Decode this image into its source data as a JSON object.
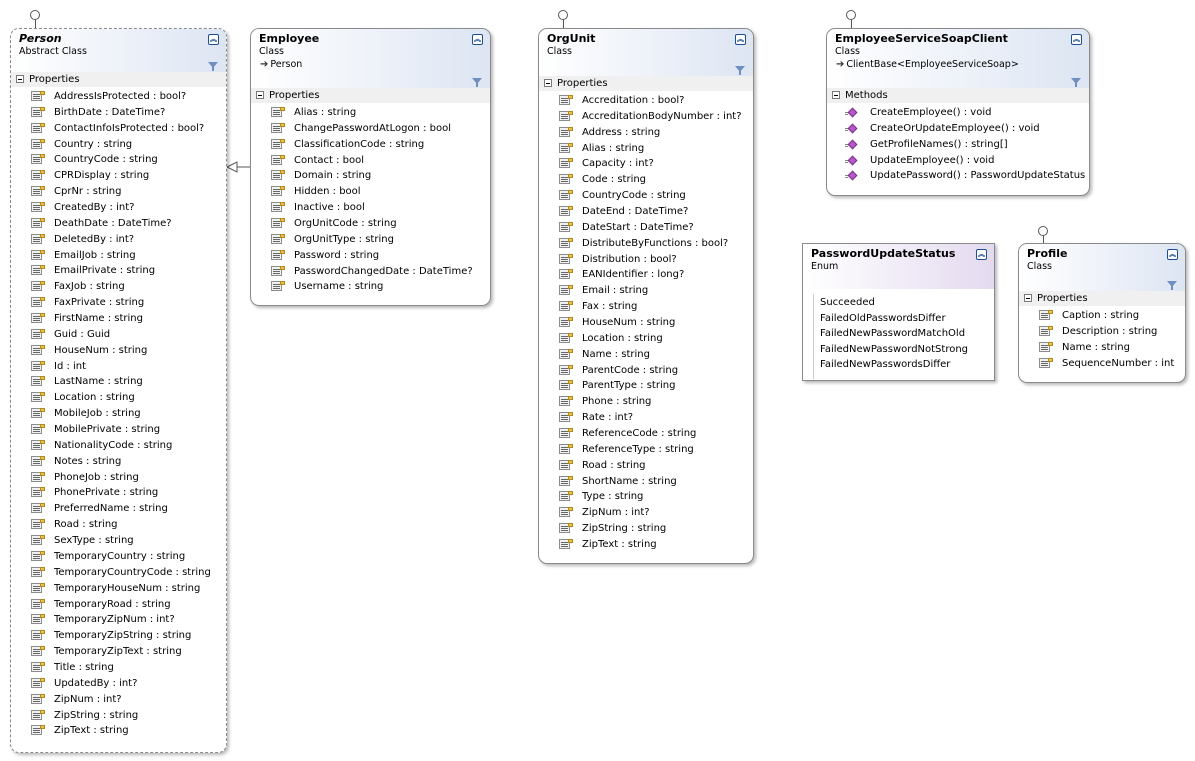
{
  "classes": {
    "person": {
      "name": "Person",
      "stereotype": "Abstract Class",
      "section": "Properties",
      "items": [
        "AddressIsProtected : bool?",
        "BirthDate : DateTime?",
        "ContactInfoIsProtected : bool?",
        "Country : string",
        "CountryCode : string",
        "CPRDisplay : string",
        "CprNr : string",
        "CreatedBy : int?",
        "DeathDate : DateTime?",
        "DeletedBy : int?",
        "EmailJob : string",
        "EmailPrivate : string",
        "FaxJob : string",
        "FaxPrivate : string",
        "FirstName : string",
        "Guid : Guid",
        "HouseNum : string",
        "Id : int",
        "LastName : string",
        "Location : string",
        "MobileJob : string",
        "MobilePrivate : string",
        "NationalityCode : string",
        "Notes : string",
        "PhoneJob : string",
        "PhonePrivate : string",
        "PreferredName : string",
        "Road : string",
        "SexType : string",
        "TemporaryCountry : string",
        "TemporaryCountryCode : string",
        "TemporaryHouseNum : string",
        "TemporaryRoad : string",
        "TemporaryZipNum : int?",
        "TemporaryZipString : string",
        "TemporaryZipText : string",
        "Title : string",
        "UpdatedBy : int?",
        "ZipNum : int?",
        "ZipString : string",
        "ZipText : string"
      ]
    },
    "employee": {
      "name": "Employee",
      "stereotype": "Class",
      "parent": "Person",
      "section": "Properties",
      "items": [
        "Alias : string",
        "ChangePasswordAtLogon : bool",
        "ClassificationCode : string",
        "Contact : bool",
        "Domain : string",
        "Hidden : bool",
        "Inactive : bool",
        "OrgUnitCode : string",
        "OrgUnitType : string",
        "Password : string",
        "PasswordChangedDate : DateTime?",
        "Username : string"
      ]
    },
    "orgunit": {
      "name": "OrgUnit",
      "stereotype": "Class",
      "section": "Properties",
      "items": [
        "Accreditation : bool?",
        "AccreditationBodyNumber : int?",
        "Address : string",
        "Alias : string",
        "Capacity : int?",
        "Code : string",
        "CountryCode : string",
        "DateEnd : DateTime?",
        "DateStart : DateTime?",
        "DistributeByFunctions : bool?",
        "Distribution : bool?",
        "EANIdentifier : long?",
        "Email : string",
        "Fax : string",
        "HouseNum : string",
        "Location : string",
        "Name : string",
        "ParentCode : string",
        "ParentType : string",
        "Phone : string",
        "Rate : int?",
        "ReferenceCode : string",
        "ReferenceType : string",
        "Road : string",
        "ShortName : string",
        "Type : string",
        "ZipNum : int?",
        "ZipString : string",
        "ZipText : string"
      ]
    },
    "client": {
      "name": "EmployeeServiceSoapClient",
      "stereotype": "Class",
      "parent": "ClientBase<EmployeeServiceSoap>",
      "section": "Methods",
      "items": [
        "CreateEmployee() : void",
        "CreateOrUpdateEmployee() : void",
        "GetProfileNames() : string[]",
        "UpdateEmployee() : void",
        "UpdatePassword() : PasswordUpdateStatus"
      ]
    },
    "status": {
      "name": "PasswordUpdateStatus",
      "stereotype": "Enum",
      "items": [
        "Succeeded",
        "FailedOldPasswordsDiffer",
        "FailedNewPasswordMatchOld",
        "FailedNewPasswordNotStrong",
        "FailedNewPasswordsDiffer"
      ]
    },
    "profile": {
      "name": "Profile",
      "stereotype": "Class",
      "section": "Properties",
      "items": [
        "Caption : string",
        "Description : string",
        "Name : string",
        "SequenceNumber : int"
      ]
    }
  }
}
